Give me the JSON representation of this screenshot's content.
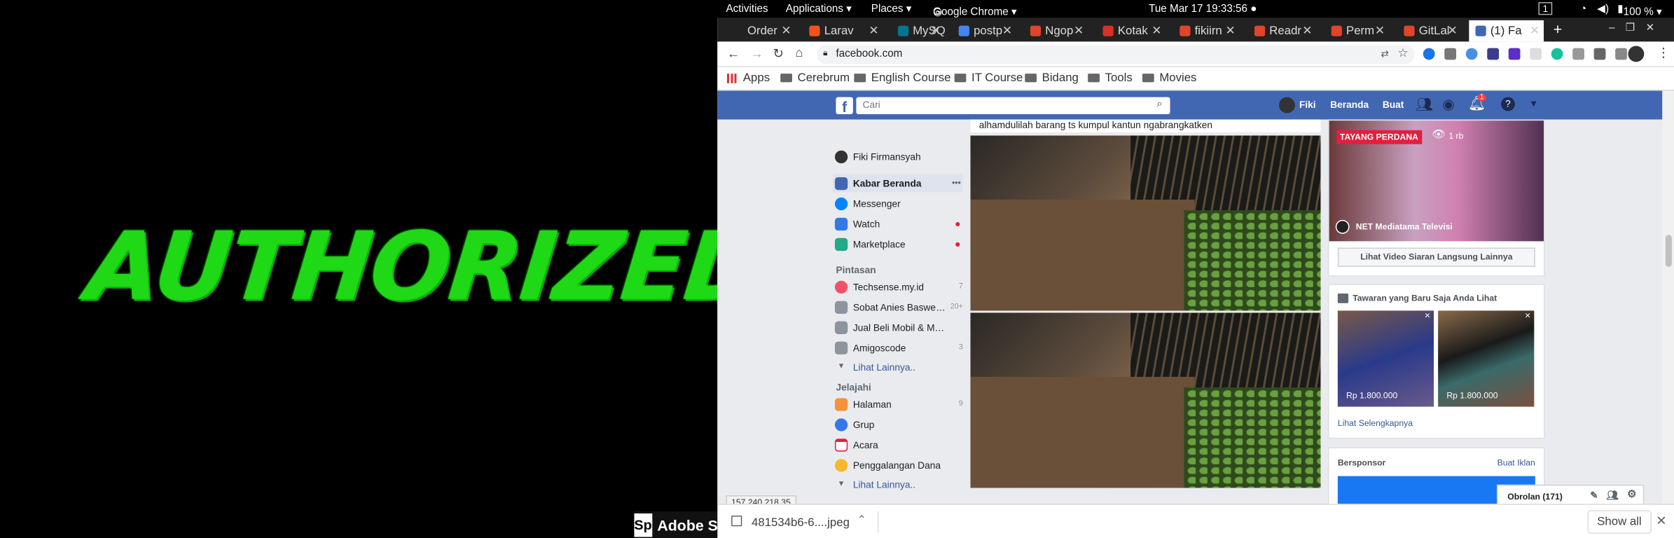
{
  "desktop": {
    "wallpaper_text": "AUTHORIZED",
    "dock_label": "Adobe S"
  },
  "topbar": {
    "activities": "Activities",
    "applications": "Applications ▾",
    "places": "Places ▾",
    "app": "Google Chrome ▾",
    "clock": "Tue Mar 17  19:33:56 ●",
    "workspace": "1",
    "battery": "100 % ▾"
  },
  "tabs": [
    {
      "label": "Order",
      "color": "#222"
    },
    {
      "label": "Larav",
      "color": "#f4511e"
    },
    {
      "label": "MySQ",
      "color": "#00758f"
    },
    {
      "label": "postp",
      "color": "#4285f4"
    },
    {
      "label": "Ngop",
      "color": "#e24329"
    },
    {
      "label": "Kotak",
      "color": "#d93025"
    },
    {
      "label": "fikiirn",
      "color": "#e24329"
    },
    {
      "label": "Readr",
      "color": "#e24329"
    },
    {
      "label": "Perm",
      "color": "#e24329"
    },
    {
      "label": "GitLal",
      "color": "#e24329"
    },
    {
      "label": "(1) Fa",
      "color": "#4267b2"
    }
  ],
  "new_tab": "+",
  "url": "facebook.com",
  "bookmarks": [
    "Apps",
    "Cerebrum",
    "English Course",
    "IT Course",
    "Bidang",
    "Tools",
    "Movies"
  ],
  "fb": {
    "search_placeholder": "Cari",
    "user": "Fiki",
    "nav_home": "Beranda",
    "nav_create": "Buat",
    "notif_count": "1",
    "profile_name": "Fiki Firmansyah",
    "main_items": [
      {
        "label": "Kabar Beranda",
        "more": "•••",
        "color": "#4267b2"
      },
      {
        "label": "Messenger",
        "color": "#0084ff"
      },
      {
        "label": "Watch",
        "color": "#3578e5"
      },
      {
        "label": "Marketplace",
        "color": "#23a88a"
      }
    ],
    "shortcuts_title": "Pintasan",
    "shortcuts": [
      {
        "label": "Techsense.my.id",
        "count": "7",
        "color": "#f25268"
      },
      {
        "label": "Sobat Anies Baswe…",
        "count": "20+",
        "color": "#8d949e"
      },
      {
        "label": "Jual Beli Mobil & M…",
        "count": "",
        "color": "#8d949e"
      },
      {
        "label": "Amigoscode",
        "count": "3",
        "color": "#8d949e"
      }
    ],
    "see_more": "Lihat Lainnya..",
    "explore_title": "Jelajahi",
    "explore": [
      {
        "label": "Halaman",
        "count": "9",
        "color": "#f7923b"
      },
      {
        "label": "Grup",
        "count": "",
        "color": "#3578e5"
      },
      {
        "label": "Acara",
        "count": "",
        "color": "#e41e3f"
      },
      {
        "label": "Penggalangan Dana",
        "count": "",
        "color": "#f7b928"
      }
    ],
    "see_more2": "Lihat Lainnya..",
    "post_text": "alhamdulilah barang ts kumpul kantun ngabrangkatken",
    "live_badge": "TAYANG PERDANA",
    "viewers": "1 rb",
    "live_channel": "NET Mediatama Televisi",
    "live_button": "Lihat Video Siaran Langsung Lainnya",
    "offers_title": "Tawaran yang Baru Saja Anda Lihat",
    "offer_prices": [
      "Rp 1.800.000",
      "Rp 1.800.000"
    ],
    "offers_more": "Lihat Selengkapnya",
    "sponsored": "Bersponsor",
    "create_ad": "Buat Iklan",
    "chat": "Obrolan (171)",
    "status_ip": "157.240.218.35"
  },
  "download": {
    "file": "481534b6-6....jpeg",
    "show_all": "Show all"
  }
}
